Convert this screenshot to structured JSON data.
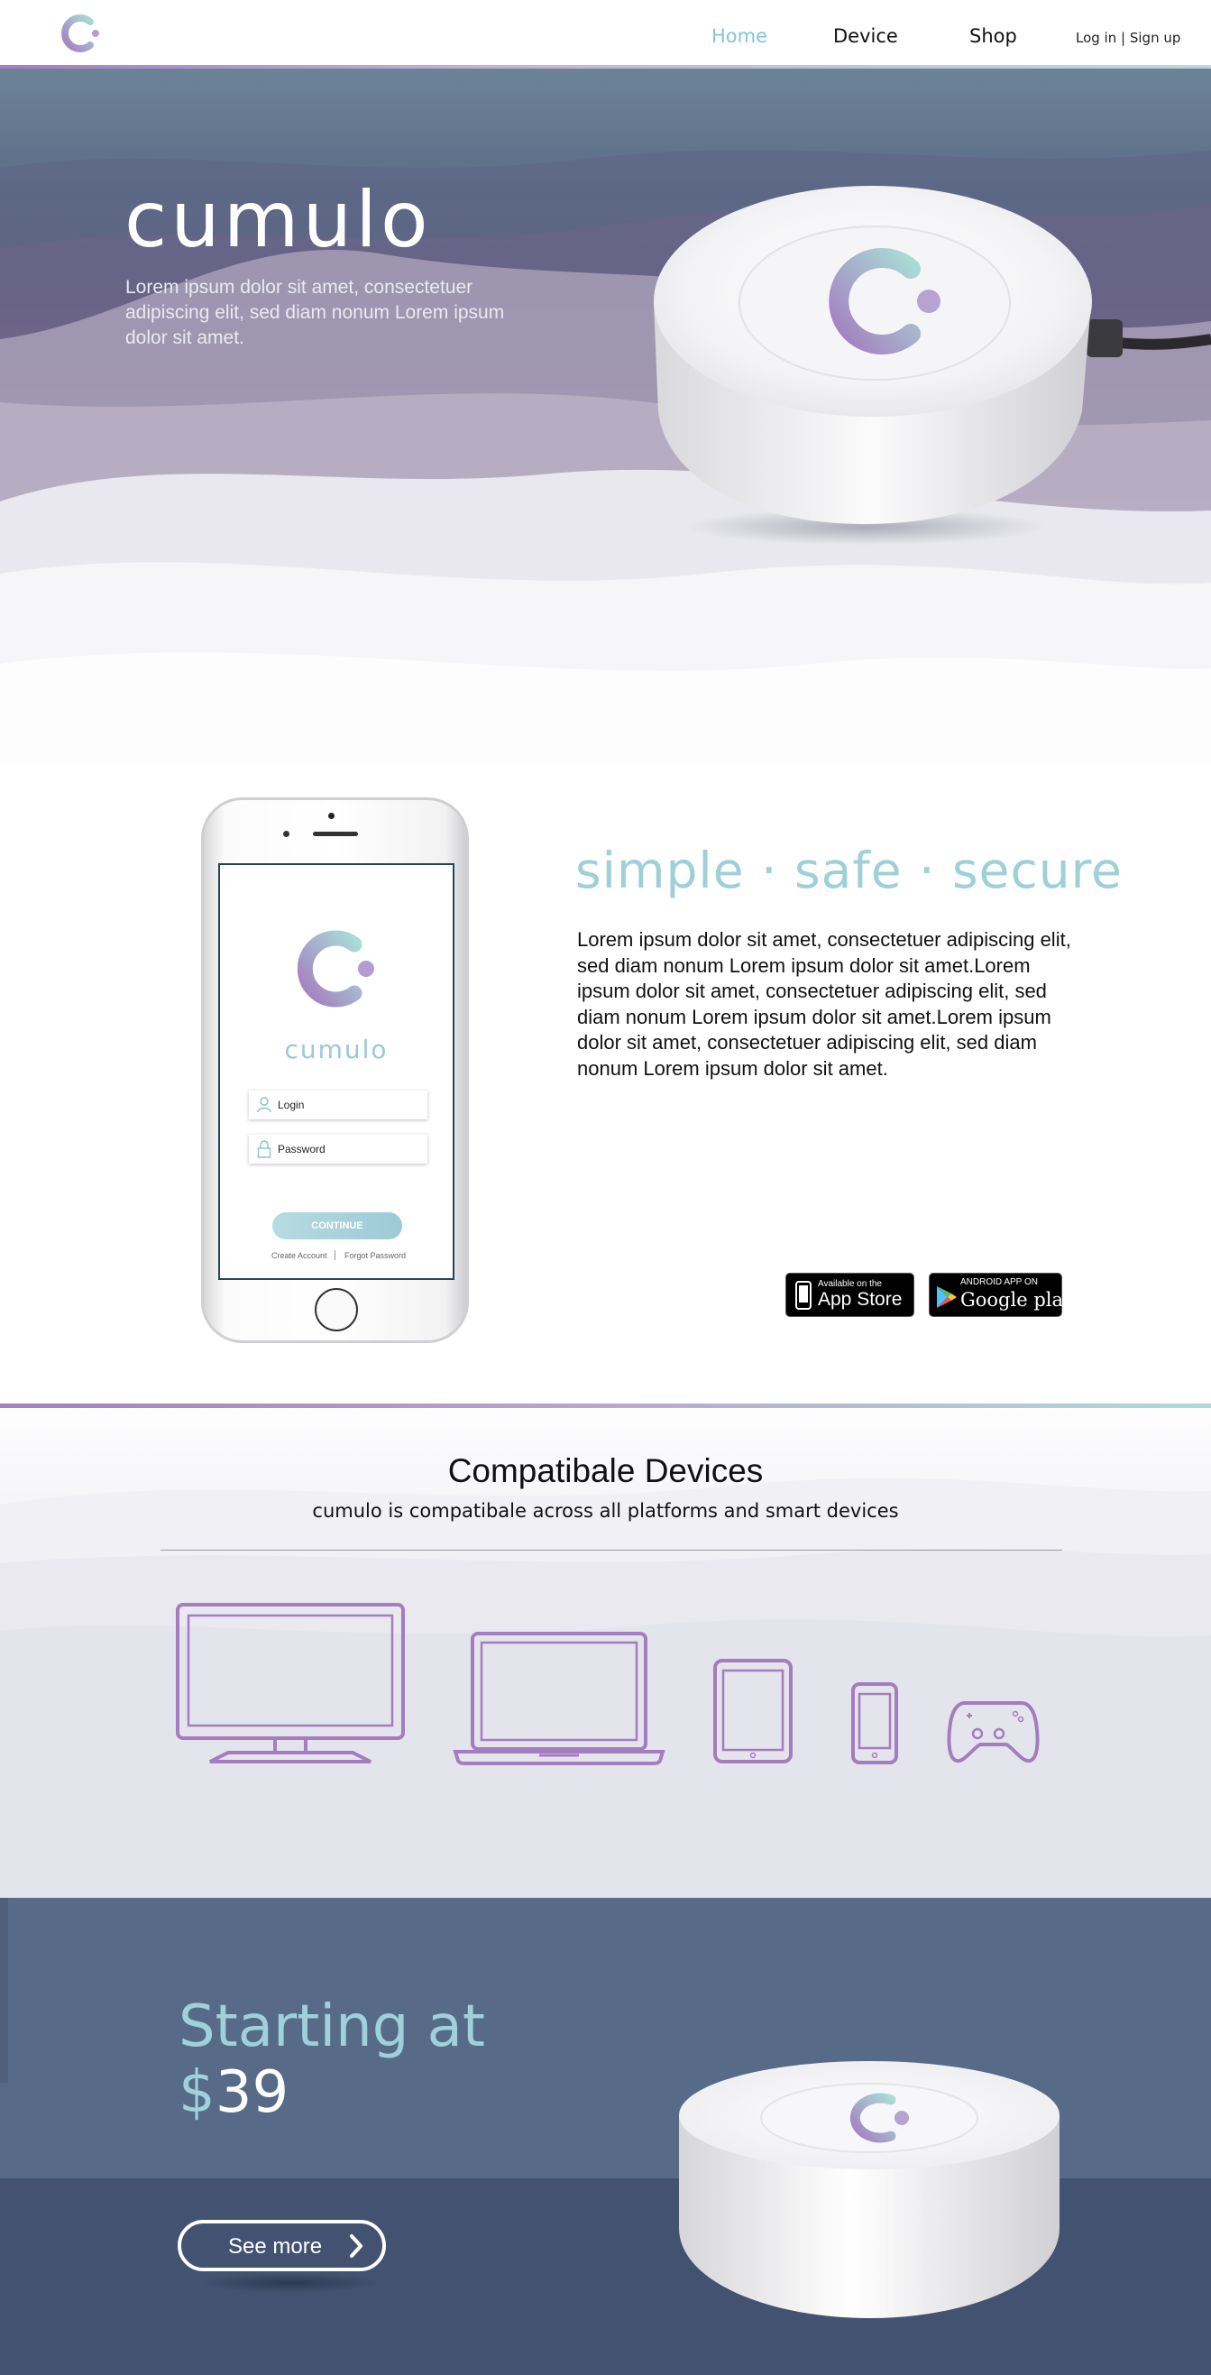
{
  "nav": {
    "links": [
      "Home",
      "Device",
      "Shop"
    ],
    "active": "Home",
    "login": "Log in",
    "separator": "|",
    "signup": "Sign up"
  },
  "hero": {
    "brand": "cumulo",
    "text": "Lorem ipsum dolor sit amet, consectetuer adipiscing elit, sed diam nonum Lorem ipsum dolor sit amet."
  },
  "feature": {
    "tagline": "simple · safe · secure",
    "text": "Lorem ipsum dolor sit amet, consectetuer adipiscing elit, sed diam nonum Lorem ipsum dolor sit amet.Lorem ipsum dolor sit amet, consectetuer adipiscing elit, sed diam nonum Lorem ipsum dolor sit amet.Lorem ipsum dolor sit amet, consectetuer adipiscing elit, sed diam nonum Lorem ipsum dolor sit amet.",
    "app_store": {
      "small": "Available on the",
      "big": "App Store"
    },
    "google_play": {
      "small": "ANDROID APP ON",
      "big": "Google play"
    }
  },
  "phone": {
    "brand": "cumulo",
    "login_placeholder": "Login",
    "password_placeholder": "Password",
    "continue": "CONTINUE",
    "create_account": "Create Account",
    "forgot_password": "Forgot Password"
  },
  "compat": {
    "title": "Compatibale Devices",
    "subtitle": "cumulo is compatibale across all platforms and smart devices",
    "devices": [
      "tv-icon",
      "laptop-icon",
      "tablet-icon",
      "smartphone-icon",
      "gamepad-icon"
    ]
  },
  "pricing": {
    "line1": "Starting at",
    "dollar": "$",
    "amount": "39",
    "button": "See more"
  },
  "colors": {
    "accent_teal": "#9fd0d8",
    "accent_purple": "#a67fbf",
    "pricing_bg": "#576a88",
    "pricing_bg_dark": "#425270"
  }
}
